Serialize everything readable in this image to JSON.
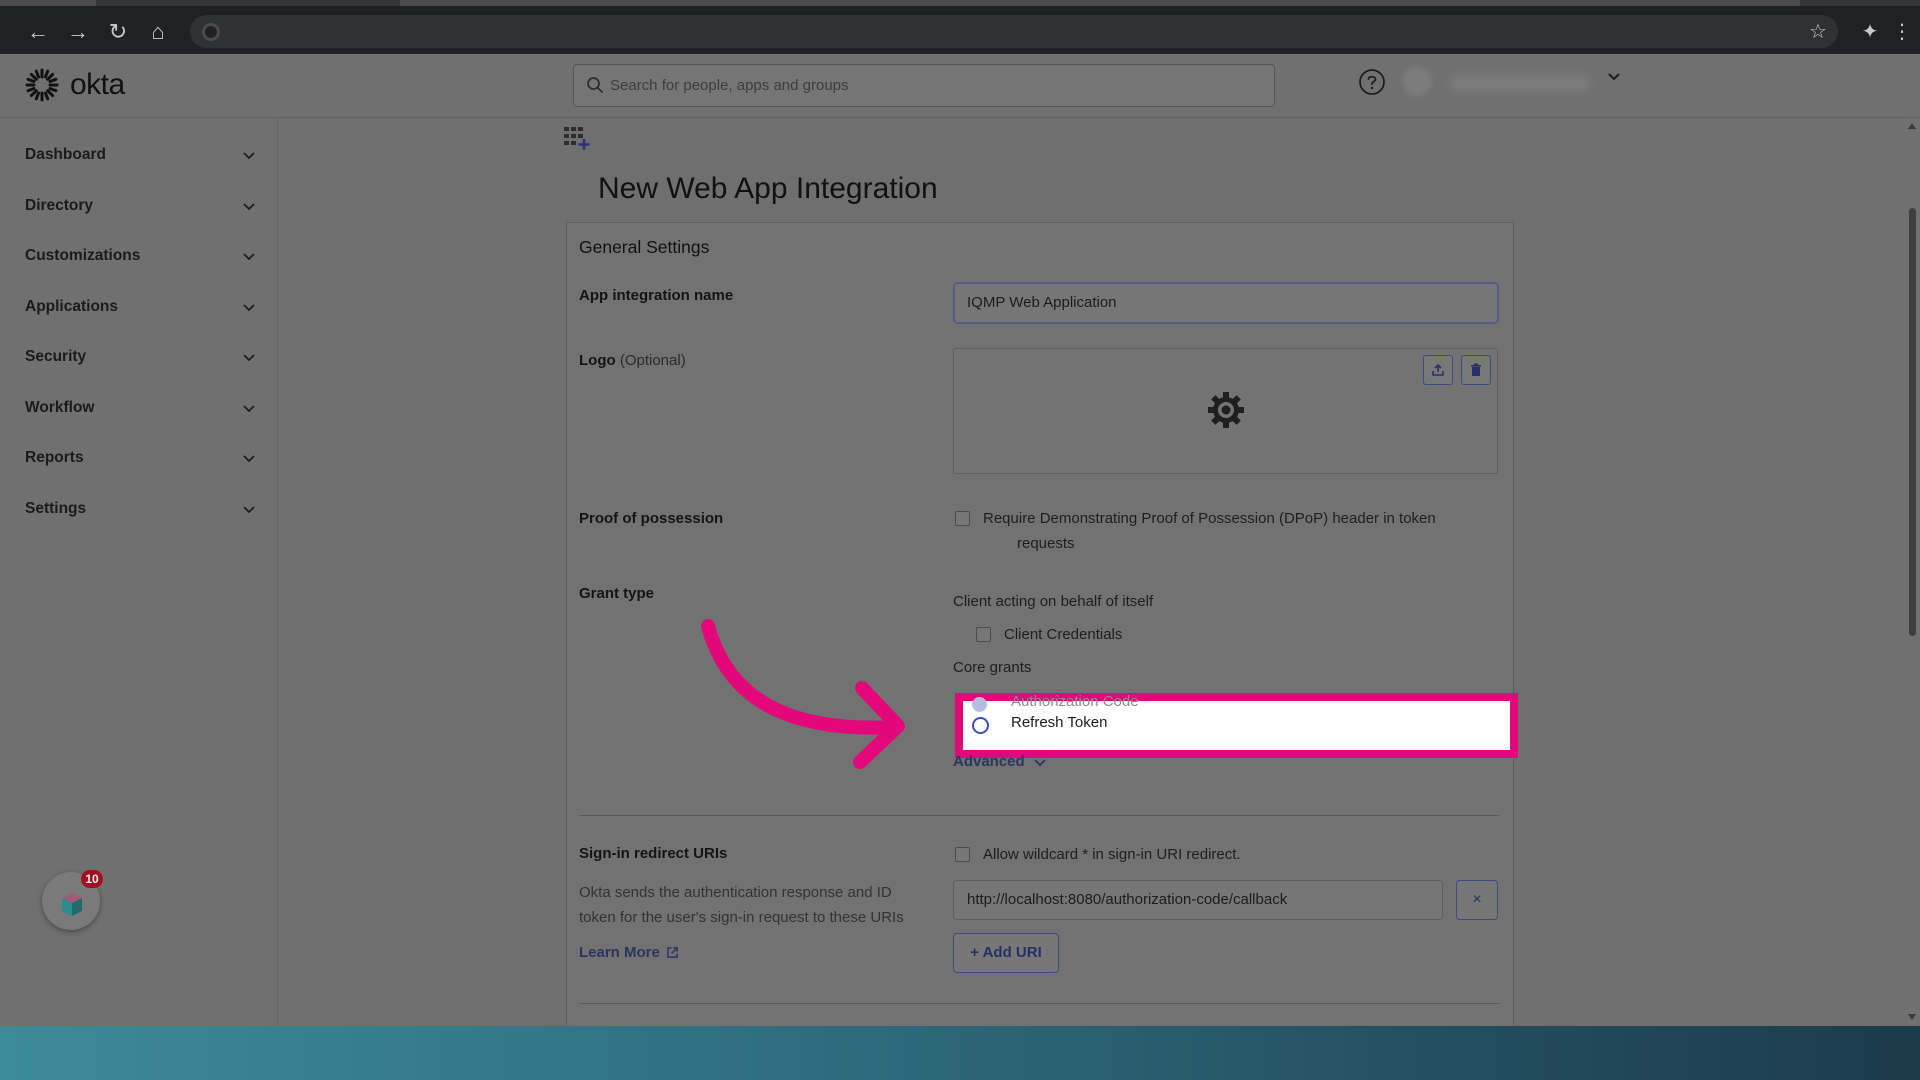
{
  "header": {
    "search_placeholder": "Search for people, apps and groups"
  },
  "logo": {
    "text": "okta"
  },
  "sidebar": {
    "items": [
      {
        "label": "Dashboard"
      },
      {
        "label": "Directory"
      },
      {
        "label": "Customizations"
      },
      {
        "label": "Applications"
      },
      {
        "label": "Security"
      },
      {
        "label": "Workflow"
      },
      {
        "label": "Reports"
      },
      {
        "label": "Settings"
      }
    ]
  },
  "help_widget": {
    "badge": "10"
  },
  "page": {
    "title": "New Web App Integration",
    "section_title": "General Settings",
    "app_name": {
      "label": "App integration name",
      "value": "IQMP Web Application"
    },
    "logo": {
      "label": "Logo",
      "optional": "(Optional)"
    },
    "proof": {
      "label": "Proof of possession",
      "checkbox_line1": "Require Demonstrating Proof of Possession (DPoP) header in token",
      "checkbox_line2": "requests"
    },
    "grant_type": {
      "label": "Grant type",
      "behalf_heading": "Client acting on behalf of itself",
      "client_credentials": "Client Credentials",
      "core_heading": "Core grants",
      "authorization_code": "Authorization Code",
      "refresh_token": "Refresh Token",
      "advanced": "Advanced"
    },
    "redirect": {
      "label": "Sign-in redirect URIs",
      "wildcard": "Allow wildcard * in sign-in URI redirect.",
      "desc_line1": "Okta sends the authentication response and ID",
      "desc_line2": "token for the user's sign-in request to these URIs",
      "learn_more": "Learn More",
      "uri_value": "http://localhost:8080/authorization-code/callback",
      "remove": "×",
      "add_uri": "Add URI"
    }
  },
  "colors": {
    "highlight": "#e4077c",
    "link": "#2c3462"
  }
}
